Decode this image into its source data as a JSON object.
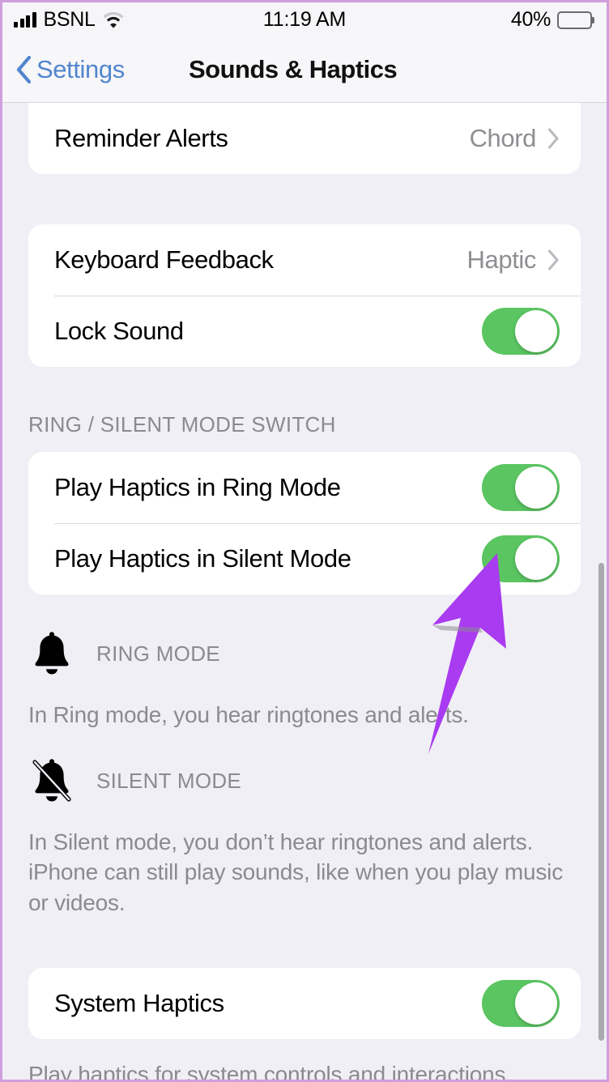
{
  "status_bar": {
    "carrier": "BSNL",
    "signal_icon": "cellular-bars-icon",
    "wifi_icon": "wifi-icon",
    "time": "11:19 AM",
    "battery_percent": "40%",
    "battery_icon": "battery-icon",
    "battery_level": 40
  },
  "nav_bar": {
    "back_icon": "chevron-left-icon",
    "back_label": "Settings",
    "title": "Sounds & Haptics"
  },
  "groups": {
    "alerts": {
      "rows": [
        {
          "label": "Reminder Alerts",
          "value": "Chord",
          "accessory": "chevron-right-icon"
        }
      ]
    },
    "keyboard": {
      "rows": [
        {
          "label": "Keyboard Feedback",
          "value": "Haptic",
          "accessory": "chevron-right-icon"
        },
        {
          "label": "Lock Sound",
          "accessory": "toggle",
          "value_state": "on"
        }
      ]
    },
    "ring_silent": {
      "header": "RING / SILENT MODE SWITCH",
      "rows": [
        {
          "label": "Play Haptics in Ring Mode",
          "accessory": "toggle",
          "value_state": "on"
        },
        {
          "label": "Play Haptics in Silent Mode",
          "accessory": "toggle",
          "value_state": "on"
        }
      ],
      "modes": [
        {
          "icon": "bell-icon",
          "title": "RING MODE",
          "description": "In Ring mode, you hear ringtones and alerts."
        },
        {
          "icon": "bell-slash-icon",
          "title": "SILENT MODE",
          "description": "In Silent mode, you don’t hear ringtones and alerts. iPhone can still play sounds, like when you play music or videos."
        }
      ]
    },
    "system_haptics": {
      "rows": [
        {
          "label": "System Haptics",
          "accessory": "toggle",
          "value_state": "on"
        }
      ],
      "footer": "Play haptics for system controls and interactions."
    }
  },
  "annotation": {
    "type": "arrow",
    "name": "purple-annotation-arrow",
    "color": "#a93bf0",
    "points_to": "Play Haptics in Silent Mode toggle"
  },
  "colors": {
    "toggle_on": "#5ac561",
    "tint_blue": "#5186cd",
    "secondary_text": "#8a8a8f",
    "page_background": "#f1eff6",
    "card_background": "#ffffff",
    "frame_border": "#cf9fdd"
  }
}
